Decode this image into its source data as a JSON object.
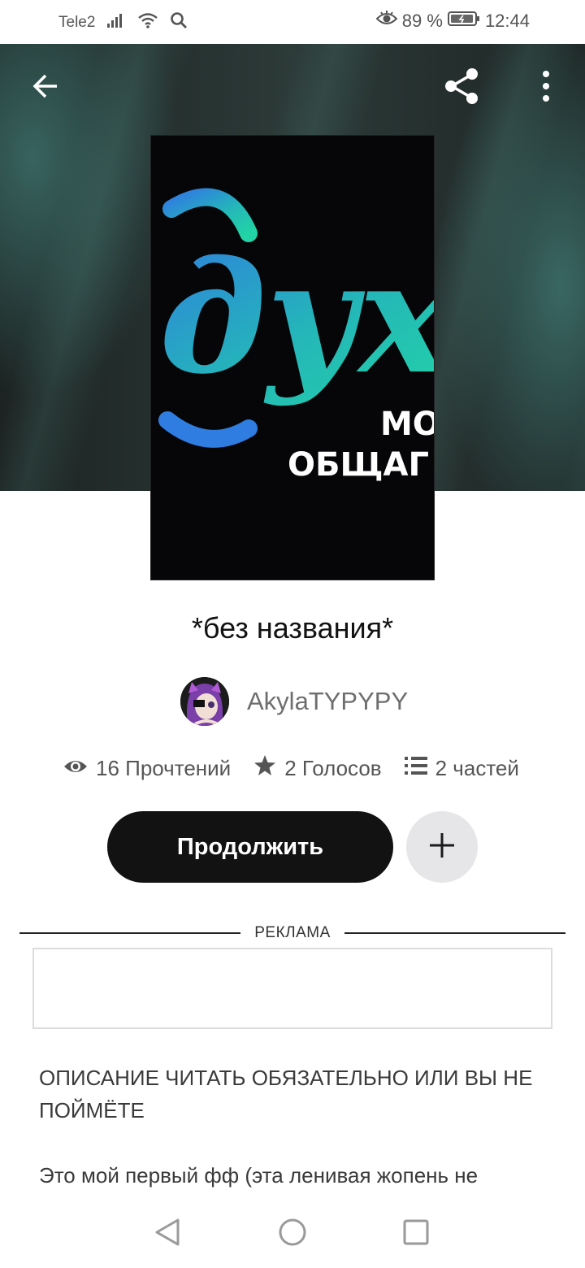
{
  "status_bar": {
    "carrier": "Tele2",
    "battery_percent": "89 %",
    "time": "12:44",
    "icons": [
      "signal-icon",
      "wifi-icon",
      "search-icon",
      "eye-icon",
      "battery-icon"
    ]
  },
  "toolbar": {
    "back_icon": "arrow-left-icon",
    "share_icon": "share-icon",
    "more_icon": "more-vertical-icon"
  },
  "story": {
    "title": "*без названия*",
    "author": "AkylaTYPYPY",
    "cover_text_large": "дух",
    "cover_text_small_1": "МО",
    "cover_text_small_2": "ОБЩАГ"
  },
  "stats": {
    "reads": "16 Прочтений",
    "votes": "2 Голосов",
    "parts": "2 частей"
  },
  "actions": {
    "continue_label": "Продолжить"
  },
  "ad": {
    "label": "РЕКЛАМА"
  },
  "description": {
    "paragraph_1": "ОПИСАНИЕ ЧИТАТЬ ОБЯЗАТЕЛЬНО ИЛИ ВЫ НЕ ПОЙМЁТЕ",
    "paragraph_2": "Это мой первый фф (эта ленивая жопень не"
  },
  "colors": {
    "button_dark": "#121212",
    "button_light": "#e6e6e8",
    "cover_gradient_start": "#2f7de0",
    "cover_gradient_end": "#22d3a6"
  }
}
